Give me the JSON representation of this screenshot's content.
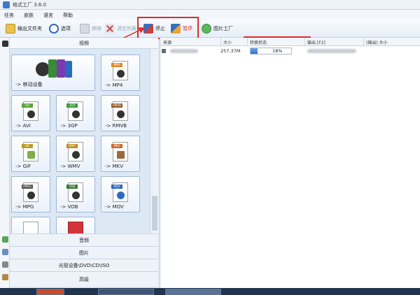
{
  "window": {
    "title": "格式工厂 3.6.0"
  },
  "menu": [
    "任务",
    "皮肤",
    "语言",
    "帮助"
  ],
  "toolbar": {
    "output_folder": "输出文件夹",
    "options": "选项",
    "remove": "移除",
    "clear": "清空列表",
    "stop": "停止",
    "pause": "暂停",
    "picture_factory": "图片工厂"
  },
  "categories": {
    "video": "视频",
    "audio": "音频",
    "image": "图片",
    "rom": "光驱设备\\DVD\\CD\\ISO",
    "advanced": "高级"
  },
  "video_tiles": [
    {
      "label": "-> 移动设备",
      "tag": "",
      "color": "#444444"
    },
    {
      "label": "-> MP4",
      "tag": "MP4",
      "color": "#e08a2a"
    },
    {
      "label": "-> AVI",
      "tag": "AVI",
      "color": "#5aa33a"
    },
    {
      "label": "-> 3GP",
      "tag": "3GP",
      "color": "#3d9b3d"
    },
    {
      "label": "-> RMVB",
      "tag": "RMVB",
      "color": "#9a5a2a"
    },
    {
      "label": "-> GIF",
      "tag": "GIF",
      "color": "#c09a20"
    },
    {
      "label": "-> WMV",
      "tag": "WMV",
      "color": "#c08a20"
    },
    {
      "label": "-> MKV",
      "tag": "MKV",
      "color": "#cc6a2a"
    },
    {
      "label": "-> MPG",
      "tag": "MPEG",
      "color": "#555555"
    },
    {
      "label": "-> VOB",
      "tag": "VOB",
      "color": "#3a7a3a"
    },
    {
      "label": "-> MOV",
      "tag": "MOV",
      "color": "#2a6ac0"
    }
  ],
  "list": {
    "headers": {
      "source": "来源",
      "size": "大小",
      "status": "转换状态",
      "output": "输出 [F2]",
      "output_size": "(输出) 大小"
    },
    "row": {
      "size": "257.37M",
      "progress_percent": 18,
      "progress_text": "18%"
    }
  },
  "colors": {
    "annotation": "#e22a2a",
    "progress": "#2f6fd0"
  }
}
